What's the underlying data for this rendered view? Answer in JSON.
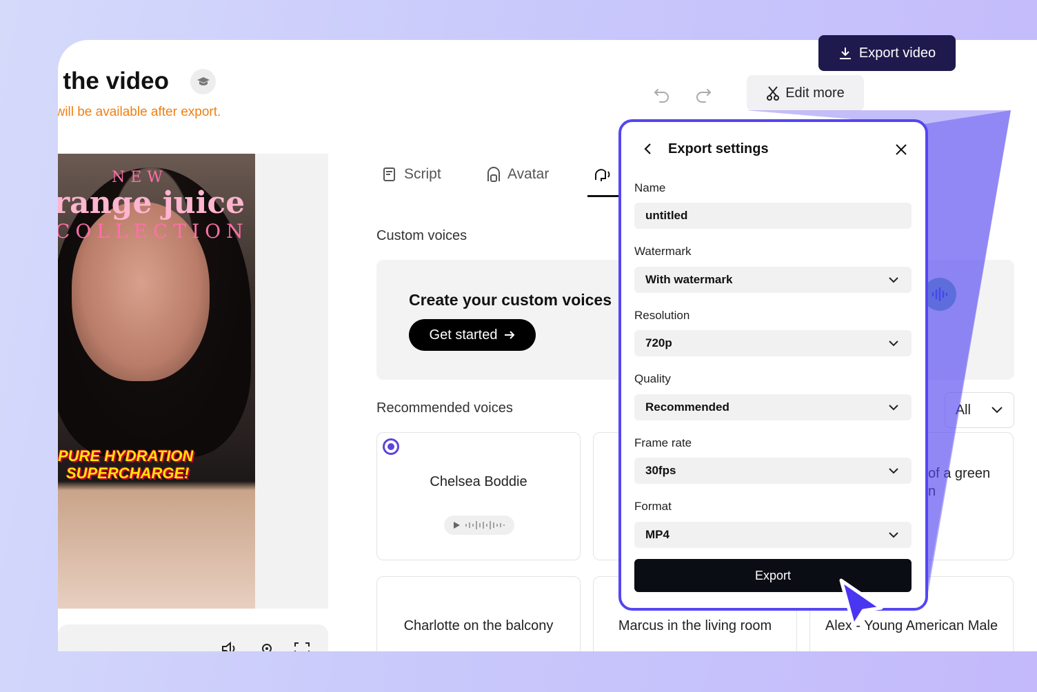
{
  "header": {
    "title": "t the video",
    "subtitle": ": will be available after export.",
    "edit_more": "Edit more",
    "export_video": "Export video"
  },
  "video": {
    "overlay_new": "NEW",
    "overlay_title": "range juice",
    "overlay_collection": "COLLECTION",
    "caption_line1": "PURE HYDRATION",
    "caption_line2": "SUPERCHARGE!"
  },
  "tabs": [
    {
      "label": "Script",
      "icon": "script-icon"
    },
    {
      "label": "Avatar",
      "icon": "avatar-icon"
    },
    {
      "label": "",
      "icon": "voice-icon"
    }
  ],
  "custom_voices": {
    "section_label": "Custom voices",
    "card_title": "Create your custom voices",
    "get_started": "Get started"
  },
  "recommended": {
    "section_label": "Recommended voices",
    "filter": "All",
    "cards": [
      {
        "name": "Chelsea Boddie",
        "selected": true
      },
      {
        "name": "Charlotte on the balcony"
      },
      {
        "name": "Marcus in the living room"
      },
      {
        "name": "Alex - Young American Male"
      }
    ],
    "partial_card_text_1": "of a green",
    "partial_card_text_2": "n"
  },
  "export_panel": {
    "title": "Export settings",
    "fields": [
      {
        "label": "Name",
        "value": "untitled",
        "dropdown": false
      },
      {
        "label": "Watermark",
        "value": "With watermark",
        "dropdown": true
      },
      {
        "label": "Resolution",
        "value": "720p",
        "dropdown": true
      },
      {
        "label": "Quality",
        "value": "Recommended",
        "dropdown": true
      },
      {
        "label": "Frame rate",
        "value": "30fps",
        "dropdown": true
      },
      {
        "label": "Format",
        "value": "MP4",
        "dropdown": true
      }
    ],
    "export_label": "Export"
  },
  "colors": {
    "accent": "#5446f2",
    "export_video_bg": "#1e1a4d",
    "subtitle": "#f07f12"
  }
}
